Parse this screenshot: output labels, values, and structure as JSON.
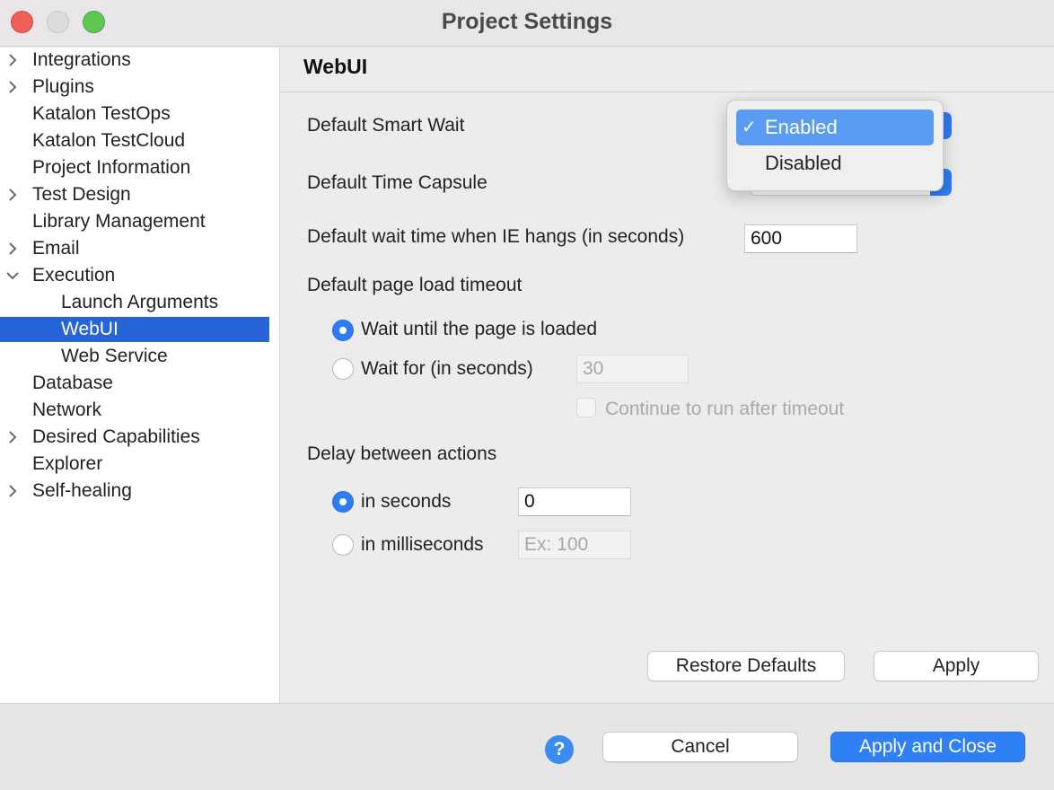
{
  "window": {
    "title": "Project Settings"
  },
  "sidebar": {
    "items": [
      {
        "label": "Integrations",
        "expandable": true
      },
      {
        "label": "Plugins",
        "expandable": true
      },
      {
        "label": "Katalon TestOps",
        "expandable": false
      },
      {
        "label": "Katalon TestCloud",
        "expandable": false
      },
      {
        "label": "Project Information",
        "expandable": false
      },
      {
        "label": "Test Design",
        "expandable": true
      },
      {
        "label": "Library Management",
        "expandable": false
      },
      {
        "label": "Email",
        "expandable": true
      },
      {
        "label": "Execution",
        "expandable": true,
        "expanded": true
      },
      {
        "label": "Launch Arguments",
        "expandable": false
      },
      {
        "label": "WebUI",
        "expandable": false,
        "selected": true
      },
      {
        "label": "Web Service",
        "expandable": false
      },
      {
        "label": "Database",
        "expandable": false
      },
      {
        "label": "Network",
        "expandable": false
      },
      {
        "label": "Desired Capabilities",
        "expandable": true
      },
      {
        "label": "Explorer",
        "expandable": false
      },
      {
        "label": "Self-healing",
        "expandable": true
      }
    ]
  },
  "page": {
    "title": "WebUI",
    "smart_wait": {
      "label": "Default Smart Wait",
      "options": [
        "Enabled",
        "Disabled"
      ],
      "selected": "Enabled"
    },
    "time_capsule": {
      "label": "Default Time Capsule"
    },
    "ie_wait": {
      "label": "Default wait time when IE hangs (in seconds)",
      "value": "600"
    },
    "page_load": {
      "label": "Default page load timeout",
      "option_loaded": "Wait until the page is loaded",
      "option_wait_for": "Wait for (in seconds)",
      "wait_for_value": "30",
      "continue_label": "Continue to run after timeout",
      "selected": "loaded"
    },
    "delay": {
      "label": "Delay between actions",
      "option_seconds": "in seconds",
      "seconds_value": "0",
      "option_ms": "in milliseconds",
      "ms_placeholder": "Ex: 100",
      "selected": "seconds"
    },
    "buttons": {
      "restore": "Restore Defaults",
      "apply": "Apply"
    }
  },
  "footer": {
    "help_icon": "?",
    "cancel": "Cancel",
    "apply_close": "Apply and Close"
  },
  "colors": {
    "accent": "#2f80f6",
    "selection": "#2765d6",
    "menu_highlight": "#5a9bf3"
  }
}
